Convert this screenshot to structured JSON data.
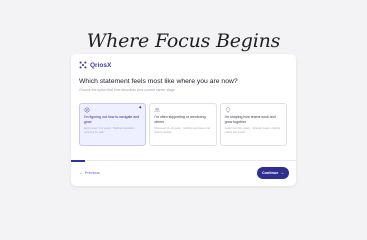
{
  "page": {
    "title": "Where Focus Begins"
  },
  "brand": {
    "name": "QriosX",
    "accent": "#2e2f8f",
    "mark_icon": "grid-dots-icon"
  },
  "question": {
    "title": "Which statement feels most like where you are now?",
    "subtitle": "Choose the option that best describes your current career stage."
  },
  "options": [
    {
      "icon": "compass-icon",
      "title": "I'm figuring out how to navigate and grow",
      "description": "Early career (0–3 years) · Building foundation, exploring the path",
      "selected": true,
      "badge_icon": "sparkle-icon"
    },
    {
      "icon": "people-icon",
      "title": "I'm often supporting or mentoring others",
      "description": "Mid-career (4–10 years) · Guiding teammates and sharing wisdom",
      "selected": false
    },
    {
      "icon": "lightbulb-icon",
      "title": "I'm shaping how teams work and grow together",
      "description": "Senior role (10+ years) · Strategic leader, shaping culture and growth",
      "selected": false
    }
  ],
  "progress": {
    "fraction": 0.06
  },
  "nav": {
    "previous_label": "Previous",
    "previous_glyph": "←",
    "continue_label": "Continue",
    "continue_glyph": "→"
  }
}
